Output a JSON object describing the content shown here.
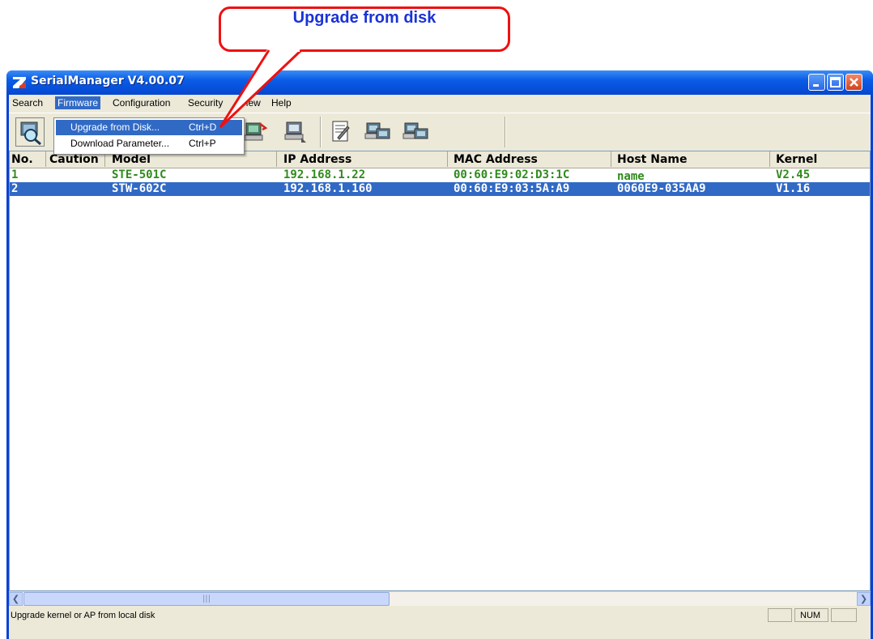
{
  "callout": {
    "text": "Upgrade from disk"
  },
  "window": {
    "title": "SerialManager V4.00.07"
  },
  "menu": [
    "Search",
    "Firmware",
    "Configuration",
    "Security",
    "View",
    "Help"
  ],
  "firmware_menu": [
    {
      "label": "Upgrade from Disk...",
      "shortcut": "Ctrl+D"
    },
    {
      "label": "Download Parameter...",
      "shortcut": "Ctrl+P"
    }
  ],
  "columns": [
    "No.",
    "Caution",
    "Model",
    "IP Address",
    "MAC Address",
    "Host Name",
    "Kernel"
  ],
  "rows": [
    {
      "no": "1",
      "caution": "",
      "model": "STE-501C",
      "ip": "192.168.1.22",
      "mac": "00:60:E9:02:D3:1C",
      "host": "name",
      "kernel": "V2.45"
    },
    {
      "no": "2",
      "caution": "",
      "model": "STW-602C",
      "ip": "192.168.1.160",
      "mac": "00:60:E9:03:5A:A9",
      "host": "0060E9-035AA9",
      "kernel": "V1.16"
    }
  ],
  "status": {
    "text": "Upgrade kernel or AP from local disk",
    "num": "NUM"
  },
  "colors": {
    "selection": "#316ac5",
    "device_text": "#2f8a1c",
    "callout_border": "#ee1111",
    "callout_text": "#1a33d6"
  }
}
